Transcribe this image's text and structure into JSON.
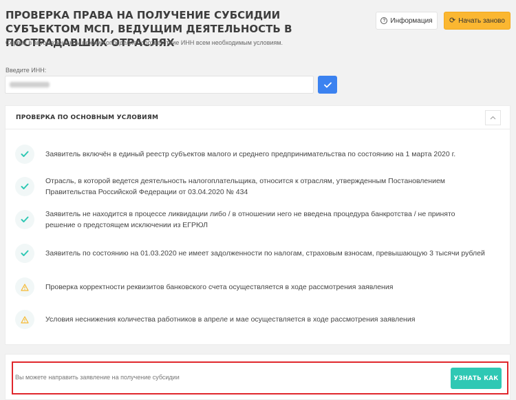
{
  "header": {
    "title": "ПРОВЕРКА ПРАВА НА ПОЛУЧЕНИЕ СУБСИДИИ СУБЪЕКТОМ МСП, ВЕДУЩИМ ДЕЯТЕЛЬНОСТЬ В ПОСТРАДАВШИХ ОТРАСЛЯХ",
    "subtitle": "Сервис в автоматическом режиме определяет соответствие ИНН всем необходимым условиям.",
    "info_label": "Информация",
    "restart_label": "Начать заново"
  },
  "inn": {
    "label": "Введите ИНН:"
  },
  "conditions": {
    "title": "ПРОВЕРКА ПО ОСНОВНЫМ УСЛОВИЯМ",
    "items": [
      {
        "status": "ok",
        "icon": "check-icon",
        "text": "Заявитель включён в единый реестр субъектов малого и среднего предпринимательства по состоянию на 1 марта 2020 г."
      },
      {
        "status": "ok",
        "icon": "check-icon",
        "text": "Отрасль, в которой ведется деятельность налогоплательщика, относится к отраслям, утвержденным Постановлением Правительства Российской Федерации от 03.04.2020 № 434"
      },
      {
        "status": "ok",
        "icon": "check-icon",
        "text": "Заявитель не находится в процессе ликвидации либо / в отношении него не введена процедура банкротства / не принято решение о предстоящем исключении из ЕГРЮЛ"
      },
      {
        "status": "ok",
        "icon": "check-icon",
        "text": "Заявитель по состоянию на 01.03.2020 не имеет задолженности по налогам, страховым взносам, превышающую 3 тысячи рублей"
      },
      {
        "status": "warning",
        "icon": "warning-icon",
        "text": "Проверка корректности реквизитов банковского счета осуществляется в ходе рассмотрения заявления"
      },
      {
        "status": "warning",
        "icon": "warning-icon",
        "text": "Условия неснижения количества работников в апреле и мае осуществляется в ходе рассмотрения заявления"
      }
    ]
  },
  "footer": {
    "text": "Вы можете направить заявление на получение субсидии",
    "button_label": "УЗНАТЬ КАК"
  },
  "colors": {
    "check": "#2fc8b4",
    "warning": "#f5b830",
    "primary": "#3b82f0",
    "accent": "#fbb731",
    "highlight": "#e0262b"
  }
}
